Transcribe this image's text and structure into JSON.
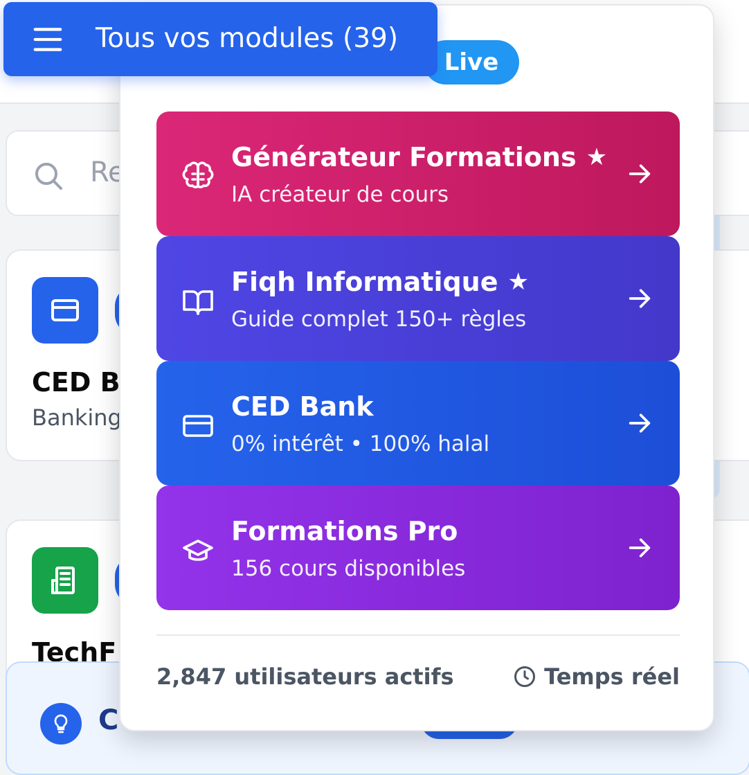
{
  "header": {
    "modules_button_label": "Tous vos modules (39)",
    "live_badge": "Live"
  },
  "background": {
    "search_placeholder": "Re",
    "cards": [
      {
        "name": "CED B",
        "sub": "Banking"
      },
      {
        "name": "TechF",
        "sub": ""
      }
    ],
    "tip_text": "C"
  },
  "modules": [
    {
      "title": "Générateur Formations",
      "star": true,
      "subtitle": "IA créateur de cours",
      "icon": "brain-icon"
    },
    {
      "title": "Fiqh Informatique",
      "star": true,
      "subtitle": "Guide complet 150+ règles",
      "icon": "book-open-icon"
    },
    {
      "title": "CED Bank",
      "star": false,
      "subtitle": "0% intérêt • 100% halal",
      "icon": "credit-card-icon"
    },
    {
      "title": "Formations Pro",
      "star": false,
      "subtitle": "156 cours disponibles",
      "icon": "graduation-cap-icon"
    }
  ],
  "footer": {
    "active_users": "2,847 utilisateurs actifs",
    "realtime": "Temps réel"
  },
  "colors": {
    "primary": "#2563eb",
    "live": "#2196f3",
    "module_pink": "#db2777",
    "module_indigo": "#4f46e5",
    "module_blue": "#2563eb",
    "module_purple": "#9333ea",
    "bank_green": "#16a34a"
  }
}
